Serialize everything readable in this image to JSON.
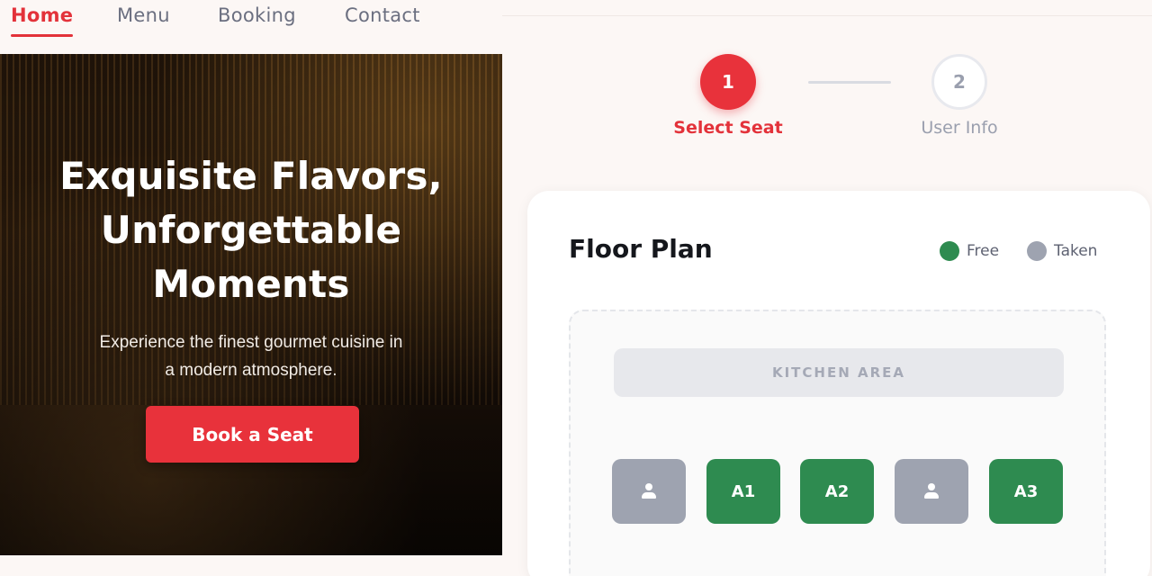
{
  "nav": {
    "items": [
      {
        "label": "Home",
        "active": true
      },
      {
        "label": "Menu",
        "active": false
      },
      {
        "label": "Booking",
        "active": false
      },
      {
        "label": "Contact",
        "active": false
      }
    ]
  },
  "hero": {
    "title_lines": [
      "Exquisite Flavors,",
      "Unforgettable",
      "Moments"
    ],
    "subtitle_lines": [
      "Experience the finest gourmet cuisine in",
      "a modern atmosphere."
    ],
    "cta_label": "Book a Seat"
  },
  "stepper": {
    "steps": [
      {
        "number": "1",
        "label": "Select Seat",
        "active": true
      },
      {
        "number": "2",
        "label": "User Info",
        "active": false
      }
    ]
  },
  "floor_plan": {
    "title": "Floor Plan",
    "legend": [
      {
        "label": "Free",
        "color": "#2e8b50"
      },
      {
        "label": "Taken",
        "color": "#9ea3b0"
      }
    ],
    "kitchen_label": "KITCHEN AREA",
    "seats": [
      {
        "label": "",
        "status": "taken",
        "icon": "person-icon"
      },
      {
        "label": "A1",
        "status": "free"
      },
      {
        "label": "A2",
        "status": "free"
      },
      {
        "label": "",
        "status": "taken",
        "icon": "person-icon"
      },
      {
        "label": "A3",
        "status": "free"
      }
    ]
  },
  "colors": {
    "accent": "#e8323b",
    "free": "#2e8b50",
    "taken": "#9ea3b0",
    "background": "#fcf7f5"
  }
}
